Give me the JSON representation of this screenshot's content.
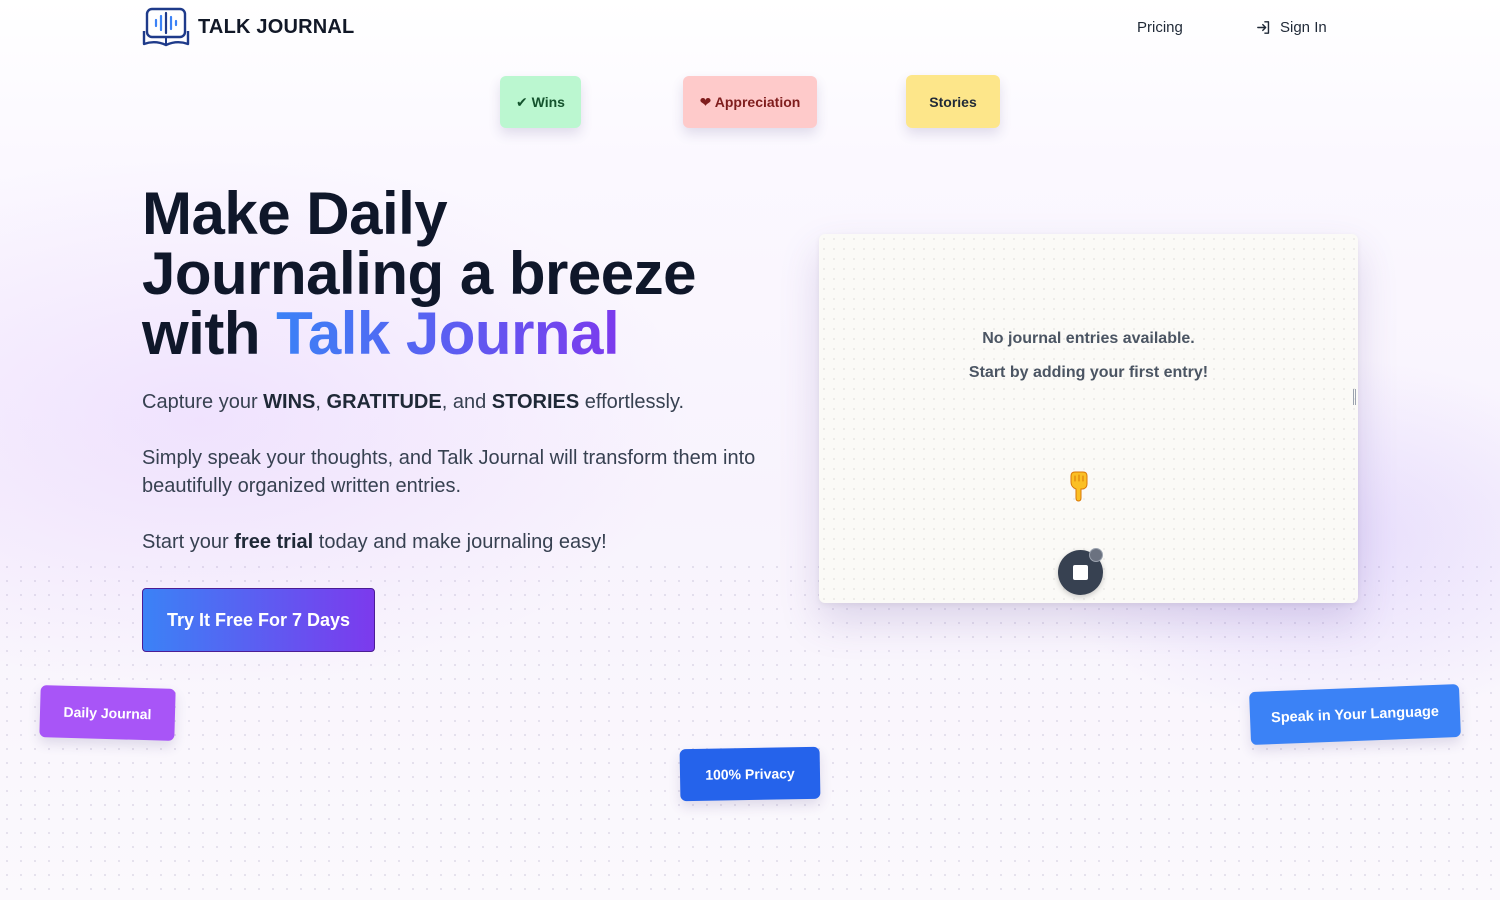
{
  "brand": {
    "name": "TALK JOURNAL"
  },
  "nav": {
    "pricing": "Pricing",
    "sign_in": "Sign In"
  },
  "tags": {
    "wins": "✔ Wins",
    "appreciation": "❤ Appreciation",
    "stories": "Stories",
    "daily_journal": "Daily Journal",
    "privacy": "100% Privacy",
    "language": "Speak in Your Language"
  },
  "hero": {
    "line1": "Make Daily",
    "line2": "Journaling a breeze",
    "line3_prefix": "with ",
    "line3_highlight": "Talk Journal",
    "p1": {
      "a": "Capture your ",
      "b1": "WINS",
      "c": ", ",
      "b2": "GRATITUDE",
      "d": ", and ",
      "b3": "STORIES",
      "e": " effortlessly."
    },
    "p2": "Simply speak your thoughts, and Talk Journal will transform them into beautifully organized written entries.",
    "p3": {
      "a": "Start your ",
      "b": "free trial",
      "c": " today and make journaling easy!"
    },
    "cta": "Try It Free For 7 Days"
  },
  "journal_panel": {
    "empty_line1": "No journal entries available.",
    "empty_line2": "Start by adding your first entry!",
    "pointer_icon": "pointing-down-hand-icon",
    "stop_icon": "stop-icon"
  },
  "colors": {
    "gradient_start": "#3b82f6",
    "gradient_end": "#7c3aed",
    "wins": "#bbf7d0",
    "appreciation": "#fecaca",
    "stories": "#fde68a",
    "daily_journal": "#a855f7",
    "privacy": "#2563eb",
    "language": "#3b82f6"
  }
}
